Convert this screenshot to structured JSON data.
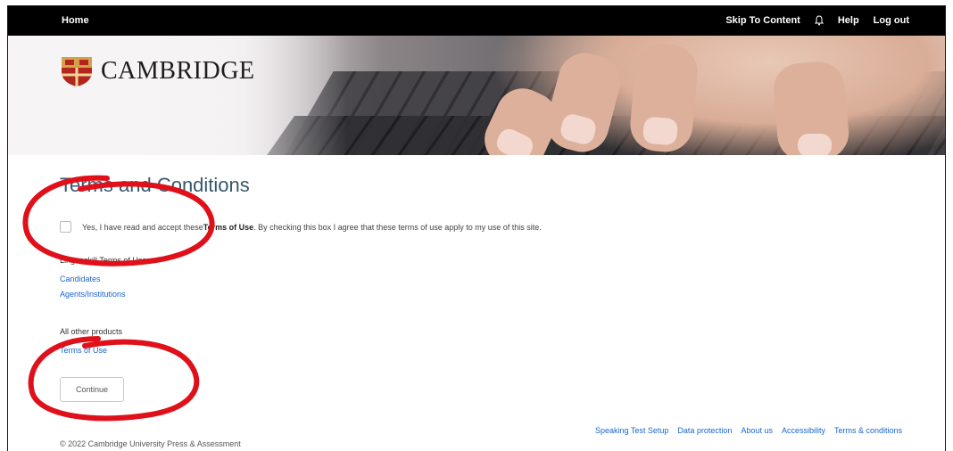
{
  "topbar": {
    "home": "Home",
    "skip_to_content": "Skip To Content",
    "help": "Help",
    "logout": "Log out"
  },
  "brand": {
    "name": "CAMBRIDGE"
  },
  "page": {
    "title": "Terms and Conditions",
    "accept_prefix": "Yes, I have read and accept these ",
    "accept_bold": "Terms of Use",
    "accept_suffix": ". By checking this box I agree that these terms of use apply to my use of this site.",
    "linguaskill_label": "Linguaskill Terms of Use:",
    "link_candidates": "Candidates",
    "link_agents": "Agents/Institutions",
    "other_label": "All other products",
    "link_terms": "Terms of Use",
    "continue_label": "Continue"
  },
  "footer": {
    "links": [
      "Speaking Test Setup",
      "Data protection",
      "About us",
      "Accessibility",
      "Terms & conditions"
    ],
    "copyright": "© 2022 Cambridge University Press & Assessment"
  },
  "colors": {
    "topbar": "#000000",
    "title": "#35586f",
    "link": "#1a66cc",
    "annotation": "#e0101a"
  }
}
